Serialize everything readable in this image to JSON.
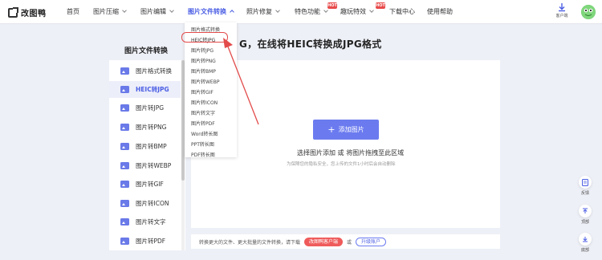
{
  "brand": {
    "name": "改图鸭"
  },
  "nav": {
    "items": [
      {
        "label": "首页"
      },
      {
        "label": "图片压缩"
      },
      {
        "label": "图片编辑"
      },
      {
        "label": "图片文件转换"
      },
      {
        "label": "照片修复"
      },
      {
        "label": "特色功能"
      },
      {
        "label": "趣玩特效"
      },
      {
        "label": "下载中心"
      },
      {
        "label": "使用帮助"
      }
    ],
    "hot_badge": "HOT",
    "client_label": "客户端"
  },
  "dropdown": {
    "items": [
      "图片格式转换",
      "HEIC转JPG",
      "图片转JPG",
      "图片转PNG",
      "图片转BMP",
      "图片转WEBP",
      "图片转GIF",
      "图片转ICON",
      "图片转文字",
      "图片转PDF",
      "Word转长图",
      "PPT转长图",
      "PDF转长图"
    ]
  },
  "page_heading": "G，在线将HEIC转换成JPG格式",
  "sidebar": {
    "title": "图片文件转换",
    "items": [
      "图片格式转换",
      "HEIC转JPG",
      "图片转JPG",
      "图片转PNG",
      "图片转BMP",
      "图片转WEBP",
      "图片转GIF",
      "图片转ICON",
      "图片转文字",
      "图片转PDF"
    ],
    "selected_index": 1
  },
  "upload": {
    "button_label": "添加图片",
    "hint": "选择图片添加 或 将图片拖拽至此区域",
    "privacy": "为保障您的隐私安全，您上传的文件1小时后会自动删除"
  },
  "bottom": {
    "text": "转换更大的文件、更大批量的文件转换，请下载",
    "client_button": "改图鸭客户端",
    "or": "或",
    "upgrade_button": "升级账户"
  },
  "float": {
    "feedback": "反馈",
    "top": "顶部",
    "bottom": "底部"
  },
  "colors": {
    "accent": "#4b5ee4",
    "button": "#6b7bef",
    "highlight_red": "#e34b4b"
  }
}
